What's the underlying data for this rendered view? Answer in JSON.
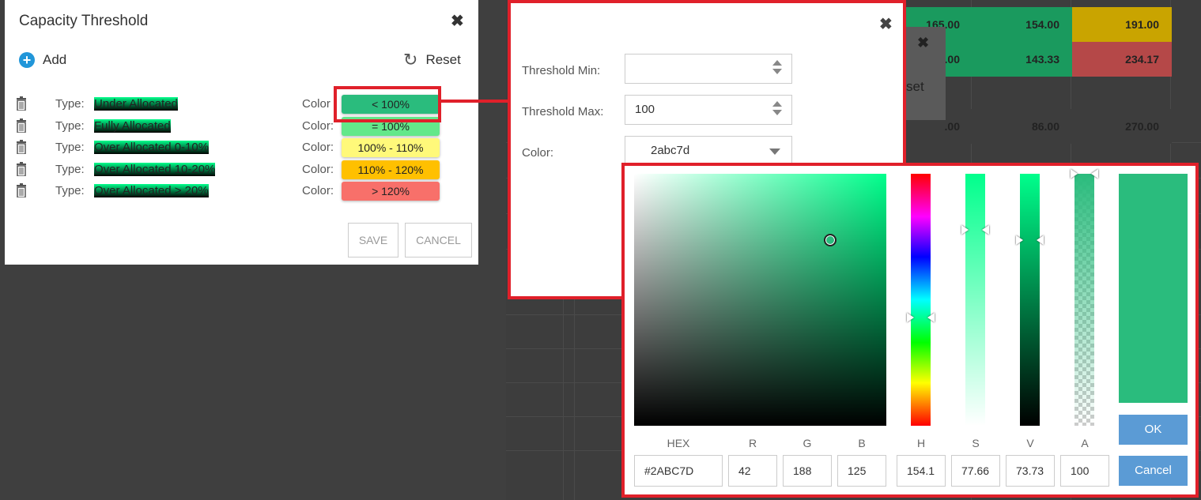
{
  "background_sheet": {
    "cells": [
      "165.00",
      "154.00",
      "191.00",
      ".00",
      "143.33",
      "234.17",
      ".00",
      "86.00",
      "270.00"
    ],
    "partial_reset_label": "set",
    "colors": {
      "green": "#1a9a5e",
      "yellow": "#c9a400",
      "red": "#b54848"
    }
  },
  "capacity_dialog": {
    "title": "Capacity Threshold",
    "add_label": "Add",
    "reset_label": "Reset",
    "type_label": "Type:",
    "color_label": "Color:",
    "first_color_label": "Color",
    "rows": [
      {
        "type": "Under Allocated",
        "range": "< 100%",
        "color": "#2abc7d"
      },
      {
        "type": "Fully Allocated",
        "range": "= 100%",
        "color": "#63e88a"
      },
      {
        "type": "Over Allocated 0-10%",
        "range": "100% - 110%",
        "color": "#fff97a"
      },
      {
        "type": "Over Allocated 10-20%",
        "range": "110% - 120%",
        "color": "#ffc000"
      },
      {
        "type": "Over Allocated > 20%",
        "range": "> 120%",
        "color": "#f8706a"
      }
    ],
    "save_label": "SAVE",
    "cancel_label": "CANCEL"
  },
  "threshold_editor": {
    "min_label": "Threshold Min:",
    "min_value": "",
    "max_label": "Threshold Max:",
    "max_value": "100",
    "color_label": "Color:",
    "color_value": "2abc7d"
  },
  "color_picker": {
    "selected_color": "#2abc7d",
    "headers": {
      "hex": "HEX",
      "r": "R",
      "g": "G",
      "b": "B",
      "h": "H",
      "s": "S",
      "v": "V",
      "a": "A"
    },
    "values": {
      "hex": "#2ABC7D",
      "r": "42",
      "g": "188",
      "b": "125",
      "h": "154.1",
      "s": "77.66",
      "v": "73.73",
      "a": "100"
    },
    "ok_label": "OK",
    "cancel_label": "Cancel"
  },
  "icons": [
    "close-icon",
    "plus-circle-icon",
    "reset-icon",
    "trash-icon",
    "spinner-up-icon",
    "spinner-down-icon",
    "dropdown-caret-icon"
  ]
}
